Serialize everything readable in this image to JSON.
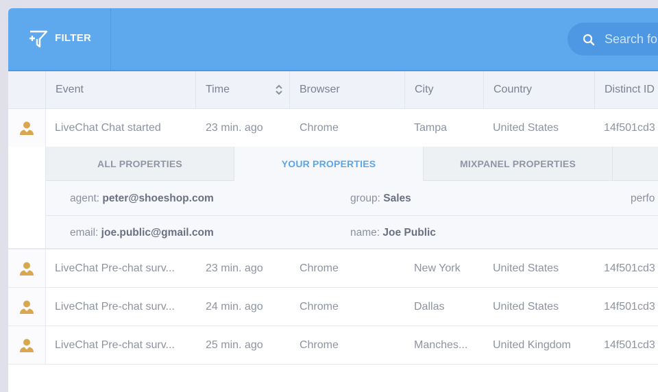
{
  "toolbar": {
    "filter_label": "FILTER",
    "filter_icon": "filter-plus-icon",
    "search_placeholder": "Search for events",
    "search_icon": "search-icon"
  },
  "table": {
    "columns": [
      {
        "label": "Event"
      },
      {
        "label": "Time",
        "sortable": true,
        "sort_icon": "sort-updown-icon"
      },
      {
        "label": "Browser"
      },
      {
        "label": "City"
      },
      {
        "label": "Country"
      },
      {
        "label": "Distinct ID"
      }
    ],
    "row_icon": "user-icon",
    "rows": [
      {
        "event": "LiveChat Chat started",
        "time": "23 min. ago",
        "browser": "Chrome",
        "city": "Tampa",
        "country": "United States",
        "distinct_id": "14f501cd3"
      },
      {
        "event": "LiveChat Pre-chat surv...",
        "time": "23 min. ago",
        "browser": "Chrome",
        "city": "New York",
        "country": "United States",
        "distinct_id": "14f501cd3"
      },
      {
        "event": "LiveChat Pre-chat surv...",
        "time": "24 min. ago",
        "browser": "Chrome",
        "city": "Dallas",
        "country": "United States",
        "distinct_id": "14f501cd3"
      },
      {
        "event": "LiveChat Pre-chat surv...",
        "time": "25 min. ago",
        "browser": "Chrome",
        "city": "Manches...",
        "country": "United Kingdom",
        "distinct_id": "14f501cd3"
      }
    ]
  },
  "details": {
    "tabs": [
      {
        "label": "ALL PROPERTIES",
        "active": false
      },
      {
        "label": "YOUR PROPERTIES",
        "active": true
      },
      {
        "label": "MIXPANEL PROPERTIES",
        "active": false
      }
    ],
    "properties": [
      [
        {
          "key": "agent:",
          "value": "peter@shoeshop.com"
        },
        {
          "key": "group:",
          "value": "Sales"
        },
        {
          "key": "perfo",
          "value": ""
        }
      ],
      [
        {
          "key": "email:",
          "value": "joe.public@gmail.com"
        },
        {
          "key": "name:",
          "value": "Joe Public"
        }
      ]
    ]
  },
  "colors": {
    "header_blue": "#5ea8ee",
    "active_tab": "#5aa6e9",
    "user_icon": "#d9a84e"
  }
}
